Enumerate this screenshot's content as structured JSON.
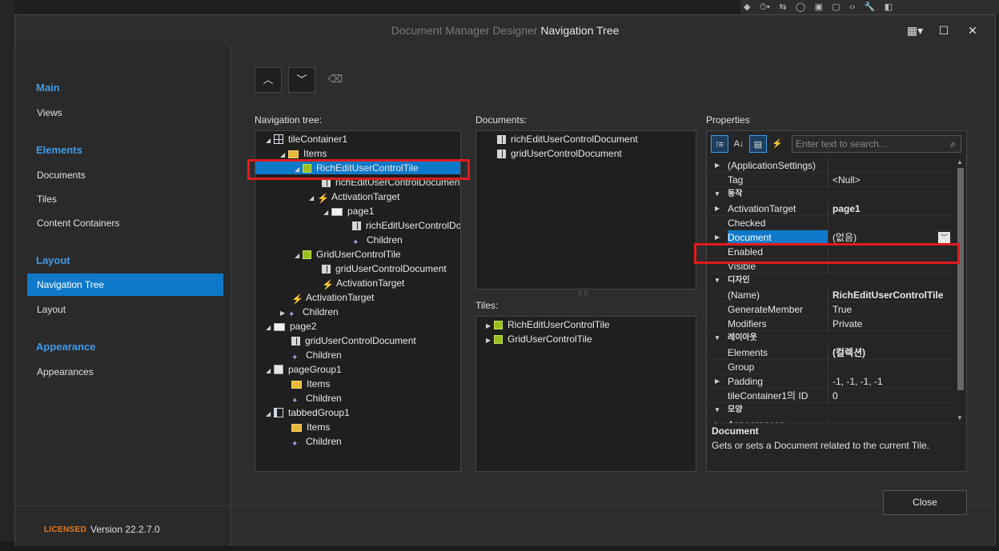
{
  "window": {
    "title_prefix": "Document Manager Designer",
    "title_main": "Navigation Tree",
    "controls": {
      "layout": "▦▾",
      "maximize": "☐",
      "close": "✕"
    }
  },
  "background": {
    "toolbar_glyphs": [
      "◆",
      "⏱▾",
      "⇆",
      "◯",
      "▣",
      "▢",
      "‹›",
      "🔧",
      "◧"
    ]
  },
  "sidebar": {
    "groups": [
      "Main",
      "Elements",
      "Layout",
      "Appearance"
    ],
    "items": {
      "views": "Views",
      "documents": "Documents",
      "tiles": "Tiles",
      "content_containers": "Content Containers",
      "navigation_tree": "Navigation Tree",
      "layout": "Layout",
      "appearances": "Appearances"
    },
    "licensed": "LICENSED",
    "version": "Version 22.2.7.0"
  },
  "toolbar": {
    "up": "︿",
    "down": "﹀",
    "eraser": "⌫"
  },
  "nav_tree": {
    "label": "Navigation tree:",
    "nodes": [
      {
        "text": "tileContainer1",
        "arrow": "◢"
      },
      {
        "text": "Items",
        "arrow": "◢"
      },
      {
        "text": "RichEditUserControlTile",
        "arrow": "◢"
      },
      {
        "text": "richEditUserControlDocument",
        "arrow": ""
      },
      {
        "text": "ActivationTarget",
        "arrow": "◢"
      },
      {
        "text": "page1",
        "arrow": "◢"
      },
      {
        "text": "richEditUserControlDocument",
        "arrow": ""
      },
      {
        "text": "Children",
        "arrow": ""
      },
      {
        "text": "GridUserControlTile",
        "arrow": "◢"
      },
      {
        "text": "gridUserControlDocument",
        "arrow": ""
      },
      {
        "text": "ActivationTarget",
        "arrow": ""
      },
      {
        "text": "ActivationTarget",
        "arrow": ""
      },
      {
        "text": "Children",
        "arrow": "▶"
      },
      {
        "text": "page2",
        "arrow": "◢"
      },
      {
        "text": "gridUserControlDocument",
        "arrow": ""
      },
      {
        "text": "Children",
        "arrow": ""
      },
      {
        "text": "pageGroup1",
        "arrow": "◢"
      },
      {
        "text": "Items",
        "arrow": ""
      },
      {
        "text": "Children",
        "arrow": ""
      },
      {
        "text": "tabbedGroup1",
        "arrow": "◢"
      },
      {
        "text": "Items",
        "arrow": ""
      },
      {
        "text": "Children",
        "arrow": ""
      }
    ]
  },
  "documents": {
    "label": "Documents:",
    "items": [
      "richEditUserControlDocument",
      "gridUserControlDocument"
    ]
  },
  "tiles": {
    "label": "Tiles:",
    "items": [
      "RichEditUserControlTile",
      "GridUserControlTile"
    ]
  },
  "properties": {
    "label": "Properties",
    "search_placeholder": "Enter text to search...",
    "toolbar_icons": [
      "sort-categorized-icon",
      "sort-alpha-icon",
      "property-pages-icon",
      "events-icon"
    ],
    "rows": [
      {
        "name": "(ApplicationSettings)",
        "value": ""
      },
      {
        "name": "Tag",
        "value": "<Null>"
      },
      {
        "category": "동작"
      },
      {
        "name": "ActivationTarget",
        "value": "page1"
      },
      {
        "name": "Checked",
        "value": ""
      },
      {
        "name": "Document",
        "value": "(없음)"
      },
      {
        "name": "Enabled",
        "value": ""
      },
      {
        "name": "Visible",
        "value": ""
      },
      {
        "category": "디자인"
      },
      {
        "name": "(Name)",
        "value": "RichEditUserControlTile"
      },
      {
        "name": "GenerateMember",
        "value": "True"
      },
      {
        "name": "Modifiers",
        "value": "Private"
      },
      {
        "category": "레이아웃"
      },
      {
        "name": "Elements",
        "value": "(컬렉션)"
      },
      {
        "name": "Group",
        "value": ""
      },
      {
        "name": "Padding",
        "value": "-1, -1, -1, -1"
      },
      {
        "name": "tileContainer1의 ID",
        "value": "0"
      },
      {
        "category": "모양"
      },
      {
        "name": "Appearances",
        "value": ""
      }
    ],
    "description_title": "Document",
    "description_text": "Gets or sets a Document related to the current Tile."
  },
  "close_label": "Close",
  "colors": {
    "accent": "#0f79c9",
    "highlight_box": "#e21b1b",
    "group_label": "#3f9be8",
    "licensed": "#e87a1e"
  }
}
